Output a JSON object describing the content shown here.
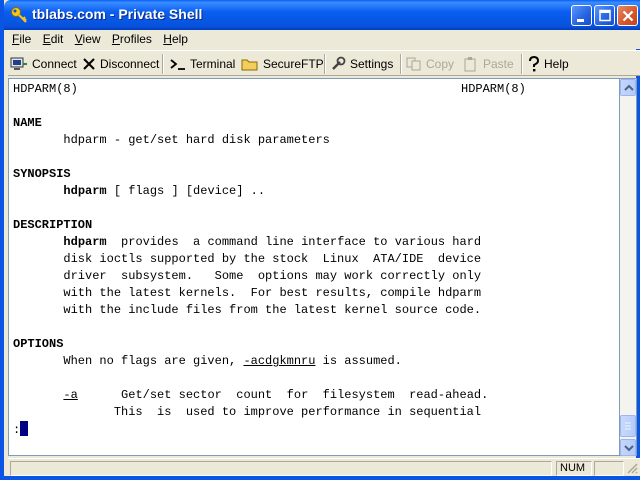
{
  "window": {
    "title": "tblabs.com - Private Shell"
  },
  "menu": {
    "items": [
      {
        "accel": "F",
        "rest": "ile"
      },
      {
        "accel": "E",
        "rest": "dit"
      },
      {
        "accel": "V",
        "rest": "iew"
      },
      {
        "accel": "P",
        "rest": "rofiles"
      },
      {
        "accel": "H",
        "rest": "elp"
      }
    ]
  },
  "toolbar": {
    "connect": "Connect",
    "disconnect": "Disconnect",
    "terminal": "Terminal",
    "secureftp": "SecureFTP",
    "settings": "Settings",
    "copy": "Copy",
    "paste": "Paste",
    "help": "Help"
  },
  "terminal": {
    "header_left": "HDPARM(8)",
    "header_right": "HDPARM(8)",
    "name_heading": "NAME",
    "name_text": "       hdparm - get/set hard disk parameters",
    "synopsis_heading": "SYNOPSIS",
    "synopsis_indent": "       ",
    "synopsis_cmd": "hdparm",
    "synopsis_rest": " [ flags ] [device] ..",
    "description_heading": "DESCRIPTION",
    "desc_indent": "       ",
    "desc_cmd": "hdparm",
    "desc_line1_rest": "  provides  a command line interface to various hard",
    "desc_line2": "       disk ioctls supported by the stock  Linux  ATA/IDE  device",
    "desc_line3": "       driver  subsystem.   Some  options may work correctly only",
    "desc_line4": "       with the latest kernels.  For best results, compile hdparm",
    "desc_line5": "       with the include files from the latest kernel source code.",
    "options_heading": "OPTIONS",
    "opt_line1_pre": "       When no flags are given, ",
    "opt_line1_flags": "-acdgkmnru",
    "opt_line1_post": " is assumed.",
    "opt_a_indent": "       ",
    "opt_a_flag": "-a",
    "opt_a_text": "      Get/set sector  count  for  filesystem  read-ahead.",
    "opt_a_line2": "              This  is  used to improve performance in sequential",
    "prompt": ":"
  },
  "status": {
    "num": "NUM"
  }
}
